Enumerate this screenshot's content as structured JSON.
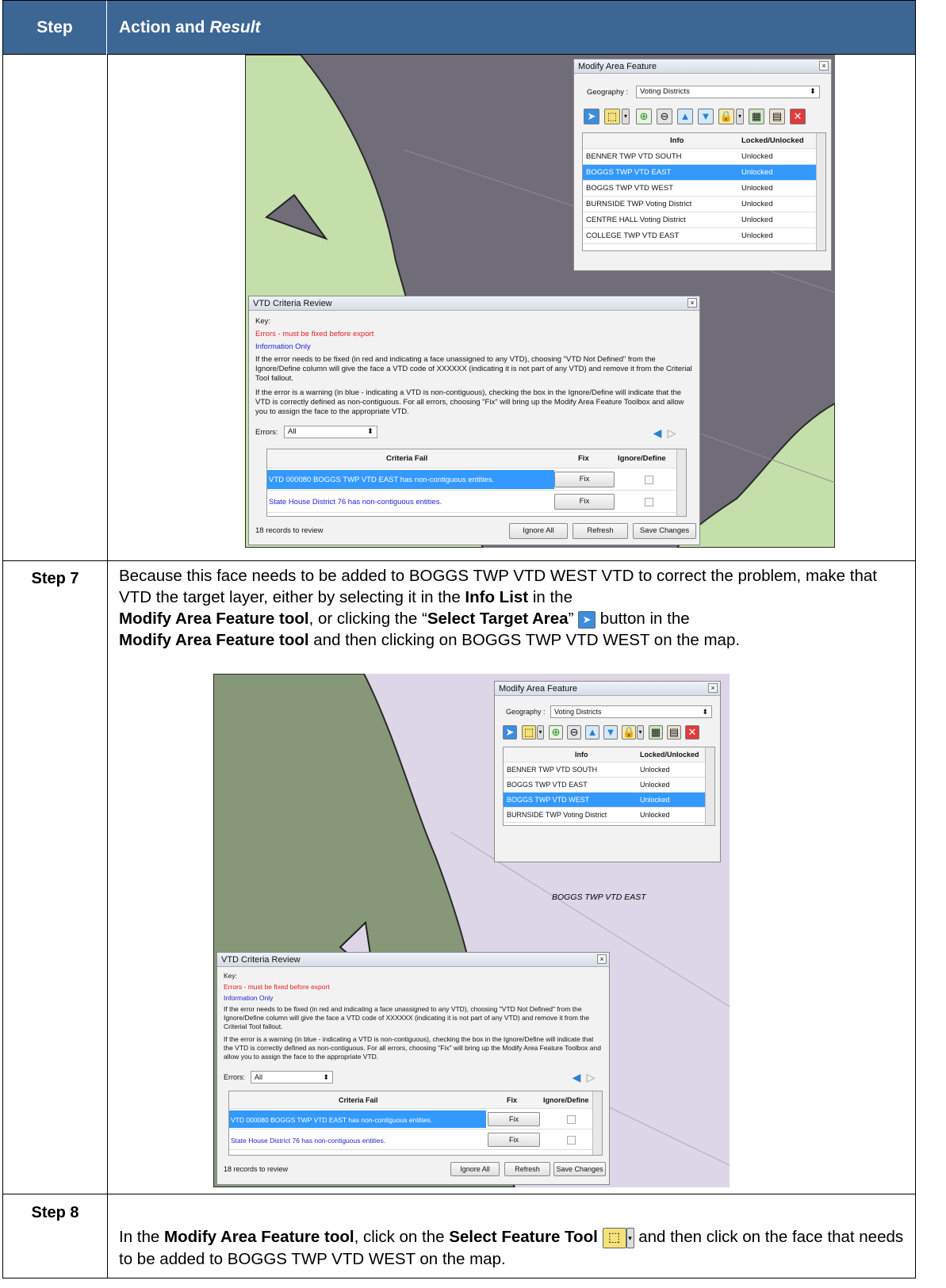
{
  "header": {
    "step_label": "Step",
    "action_label": "Action and",
    "result_label": "Result"
  },
  "screenshot1": {
    "modify_dialog": {
      "title": "Modify Area Feature",
      "close": "×",
      "geography_label": "Geography :",
      "geography_value": "Voting Districts",
      "col_info": "Info",
      "col_locked": "Locked/Unlocked",
      "rows": [
        {
          "info": "BENNER TWP VTD SOUTH",
          "status": "Unlocked",
          "selected": false
        },
        {
          "info": "BOGGS TWP VTD EAST",
          "status": "Unlocked",
          "selected": true
        },
        {
          "info": "BOGGS TWP VTD WEST",
          "status": "Unlocked",
          "selected": false
        },
        {
          "info": "BURNSIDE TWP Voting District",
          "status": "Unlocked",
          "selected": false
        },
        {
          "info": "CENTRE HALL Voting District",
          "status": "Unlocked",
          "selected": false
        },
        {
          "info": "COLLEGE TWP VTD EAST",
          "status": "Unlocked",
          "selected": false
        }
      ]
    },
    "review_dialog": {
      "title": "VTD Criteria Review",
      "close": "×",
      "key_label": "Key:",
      "errors_text": "Errors - must be fixed before export",
      "info_text": "Information Only",
      "para1": "If the error needs to be fixed (in red and indicating a face unassigned to any VTD), choosing \"VTD Not Defined\" from the Ignore/Define column will give the face a VTD code of XXXXXX (indicating it is not part of any VTD) and remove it from the Criterial Tool fallout.",
      "para2": "If the error is a warning (in blue - indicating a VTD is non-contiguous), checking the box in the Ignore/Define will indicate that the VTD is correctly defined as non-contiguous. For all errors, choosing \"Fix\" will bring up the Modify Area Feature Toolbox and allow you to assign the face to the appropriate VTD.",
      "errors_label": "Errors:",
      "errors_value": "All",
      "col_criteria": "Criteria Fail",
      "col_fix": "Fix",
      "col_ignore": "Ignore/Define",
      "rows": [
        {
          "text": "VTD 000080 BOGGS TWP VTD EAST has non-contiguous entities.",
          "fix": "Fix",
          "selected": true
        },
        {
          "text": "State House District 76 has non-contiguous entities.",
          "fix": "Fix",
          "selected": false
        }
      ],
      "records": "18 records to review",
      "ignore_all": "Ignore All",
      "refresh": "Refresh",
      "save_changes": "Save Changes"
    }
  },
  "step7": {
    "label": "Step 7",
    "t1": "Because this face needs to be added to BOGGS TWP VTD WEST VTD to correct the problem, make that VTD the target layer, either by selecting it in the ",
    "b1": "Info List",
    "t2": " in the",
    "b2": "Modify Area Feature tool",
    "t3": ", or clicking the “",
    "b3": "Select Target Area",
    "t4": "” ",
    "t5": " button in the",
    "b4": "Modify Area Feature tool",
    "t6": " and then clicking on BOGGS TWP VTD WEST on the map."
  },
  "screenshot2": {
    "map_label": "BOGGS TWP VTD EAST",
    "modify_dialog": {
      "title": "Modify Area Feature",
      "close": "×",
      "geography_label": "Geography :",
      "geography_value": "Voting Districts",
      "col_info": "Info",
      "col_locked": "Locked/Unlocked",
      "rows": [
        {
          "info": "BENNER TWP VTD SOUTH",
          "status": "Unlocked",
          "selected": false
        },
        {
          "info": "BOGGS TWP VTD EAST",
          "status": "Unlocked",
          "selected": false
        },
        {
          "info": "BOGGS TWP VTD WEST",
          "status": "Unlocked",
          "selected": true
        },
        {
          "info": "BURNSIDE TWP Voting District",
          "status": "Unlocked",
          "selected": false
        }
      ]
    },
    "review_dialog": {
      "title": "VTD Criteria Review",
      "close": "×",
      "key_label": "Key:",
      "errors_text": "Errors - must be fixed before export",
      "info_text": "Information Only",
      "para1": "If the error needs to be fixed (in red and indicating a face unassigned to any VTD), choosing \"VTD Not Defined\" from the Ignore/Define column will give the face a VTD code of XXXXXX (indicating it is not part of any VTD) and remove it from the Criterial Tool fallout.",
      "para2": "If the error is a warning (in blue - indicating a VTD is non-contiguous), checking the box in the Ignore/Define will indicate that the VTD is correctly defined as non-contiguous. For all errors, choosing \"Fix\" will bring up the Modify Area Feature Toolbox and allow you to assign the face to the appropriate VTD.",
      "errors_label": "Errors:",
      "errors_value": "All",
      "col_criteria": "Criteria Fail",
      "col_fix": "Fix",
      "col_ignore": "Ignore/Define",
      "rows": [
        {
          "text": "VTD 000080 BOGGS TWP VTD EAST has non-contiguous entities.",
          "fix": "Fix",
          "selected": true
        },
        {
          "text": "State House District 76 has non-contiguous entities.",
          "fix": "Fix",
          "selected": false
        }
      ],
      "records": "18 records to review",
      "ignore_all": "Ignore All",
      "refresh": "Refresh",
      "save_changes": "Save Changes"
    }
  },
  "step8": {
    "label": "Step 8",
    "t1": "In the ",
    "b1": "Modify Area Feature tool",
    "t2": ", click on the ",
    "b2": "Select Feature Tool",
    "t3": " and then click on the face that needs to be added to BOGGS TWP VTD WEST on the map."
  },
  "colors": {
    "header_bg": "#3c6693",
    "selection": "#3399ff",
    "error_red": "#e02020",
    "info_blue": "#2222cc"
  }
}
